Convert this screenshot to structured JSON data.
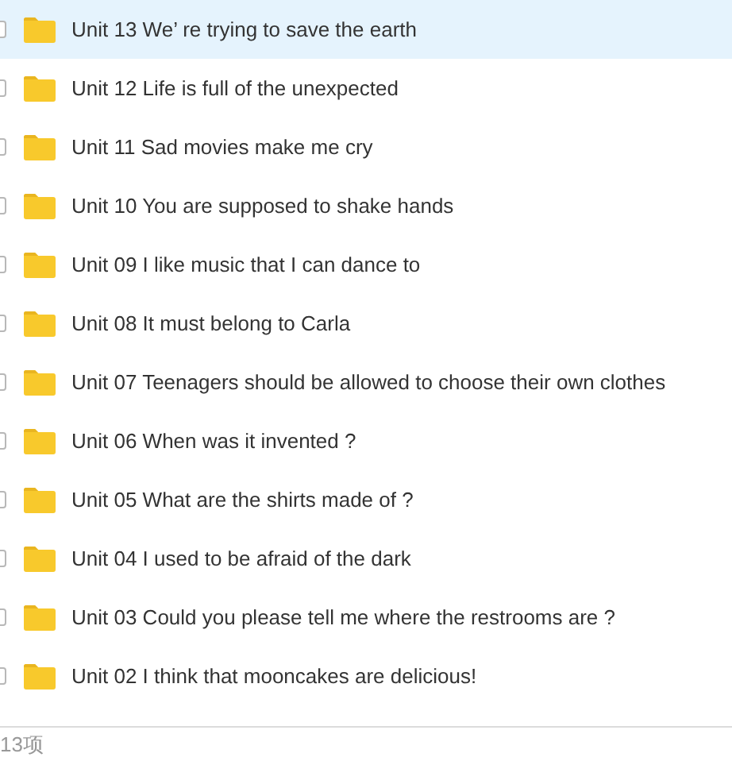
{
  "files": [
    {
      "name": "Unit 13 We’ re trying to save the earth",
      "selected": true
    },
    {
      "name": "Unit 12 Life is full of the unexpected",
      "selected": false
    },
    {
      "name": "Unit 11 Sad movies make me cry",
      "selected": false
    },
    {
      "name": "Unit 10 You are supposed to shake hands",
      "selected": false
    },
    {
      "name": "Unit 09 I like music that I can dance to",
      "selected": false
    },
    {
      "name": "Unit 08 It must belong to Carla",
      "selected": false
    },
    {
      "name": "Unit 07 Teenagers should be allowed to choose their own clothes",
      "selected": false
    },
    {
      "name": "Unit 06 When was it invented ?",
      "selected": false
    },
    {
      "name": "Unit 05 What are the shirts made of ?",
      "selected": false
    },
    {
      "name": "Unit 04 I used to be afraid of the dark",
      "selected": false
    },
    {
      "name": "Unit 03 Could you please tell me where the restrooms are ?",
      "selected": false
    },
    {
      "name": "Unit 02 I think that mooncakes are delicious!",
      "selected": false
    }
  ],
  "status_bar": {
    "count": "13项"
  }
}
